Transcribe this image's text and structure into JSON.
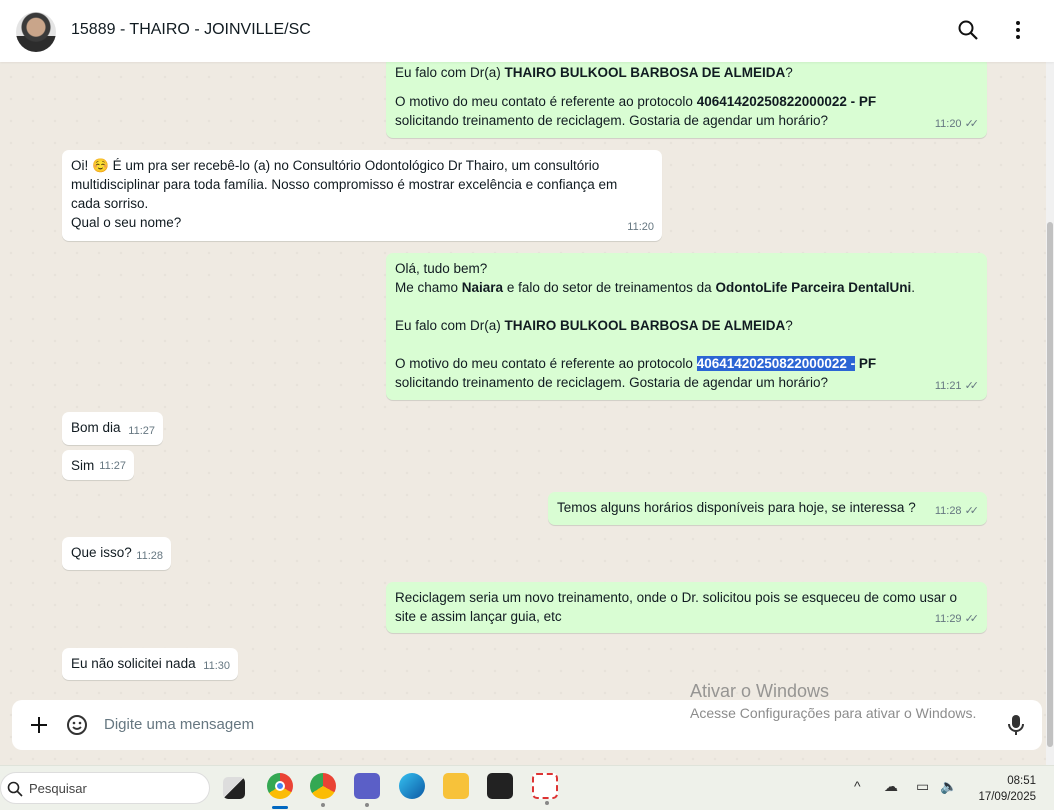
{
  "header": {
    "title": "15889 - THAIRO - JOINVILLE/SC",
    "search_icon": "search-icon",
    "menu_icon": "more-vertical-icon"
  },
  "messages": [
    {
      "dir": "out",
      "lines": {
        "l1a": "Eu falo com Dr(a) ",
        "l1b": "THAIRO BULKOOL BARBOSA DE ALMEIDA",
        "l1c": "?",
        "l2a": "O motivo do meu contato é referente ao protocolo ",
        "l2b": "40641420250822000022 - PF",
        "l3": "solicitando treinamento de reciclagem. Gostaria de agendar um horário?"
      },
      "time": "11:20"
    },
    {
      "dir": "in",
      "text1": "Oi! ",
      "emoji": "☺️",
      "text2": " É um pra ser recebê-lo (a) no Consultório Odontológico Dr Thairo, um consultório multidisciplinar para toda família. Nosso compromisso é mostrar excelência e confiança em cada sorriso.",
      "text3": "Qual o seu nome?",
      "time": "11:20"
    },
    {
      "dir": "out",
      "l1": "Olá, tudo bem?",
      "l2a": "Me chamo ",
      "l2b": "Naiara",
      "l2c": " e falo do setor de treinamentos da ",
      "l2d": "OdontoLife Parceira DentalUni",
      "l2e": ".",
      "l3a": "Eu falo com Dr(a) ",
      "l3b": "THAIRO BULKOOL BARBOSA DE ALMEIDA",
      "l3c": "?",
      "l4a": "O motivo do meu contato é referente ao protocolo ",
      "l4sel": "40641420250822000022 -",
      "l4b": " PF",
      "l5": "solicitando treinamento de reciclagem. Gostaria de agendar um horário?",
      "time": "11:21"
    },
    {
      "dir": "in",
      "text": "Bom dia",
      "time": "11:27"
    },
    {
      "dir": "in",
      "text": "Sim",
      "time": "11:27"
    },
    {
      "dir": "out",
      "text": "Temos alguns horários disponíveis para hoje, se interessa  ?",
      "time": "11:28"
    },
    {
      "dir": "in",
      "text": "Que isso?",
      "time": "11:28"
    },
    {
      "dir": "out",
      "text": "Reciclagem seria um novo treinamento, onde o Dr. solicitou pois se esqueceu de como usar o site e assim lançar guia, etc",
      "time": "11:29"
    },
    {
      "dir": "in",
      "text": "Eu não solicitei nada",
      "time": "11:30"
    }
  ],
  "composer": {
    "placeholder": "Digite uma mensagem"
  },
  "watermark": {
    "title": "Ativar o Windows",
    "subtitle": "Acesse Configurações para ativar o Windows."
  },
  "taskbar": {
    "search_placeholder": "Pesquisar",
    "time": "08:51",
    "date": "17/09/2025"
  }
}
